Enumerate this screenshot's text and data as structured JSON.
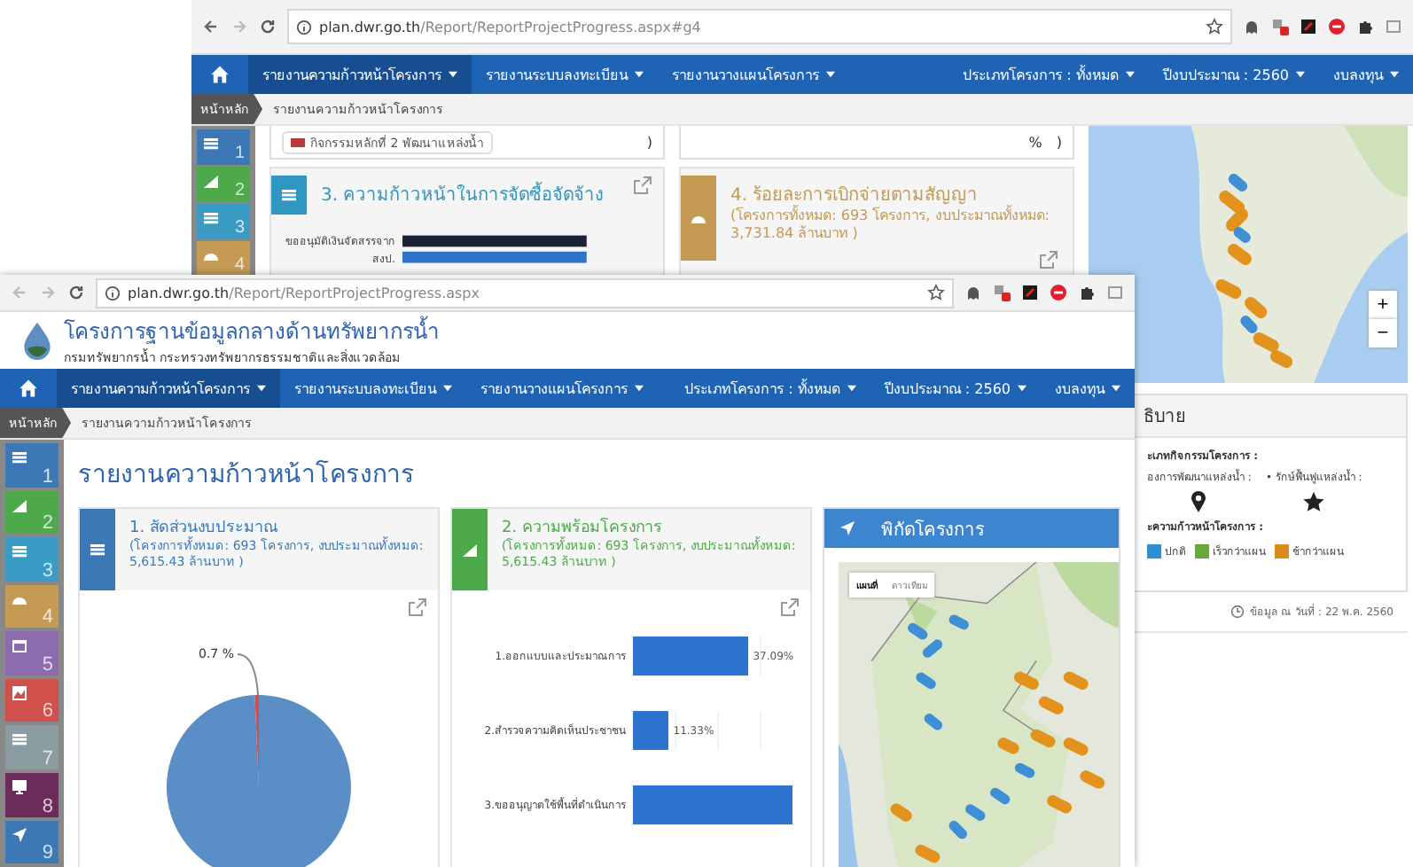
{
  "back_window": {
    "browser": {
      "url_host": "plan.dwr.go.th",
      "url_path": "/Report/ReportProjectProgress.aspx#g4"
    },
    "navbar": {
      "menus": [
        {
          "label": "รายงานความก้าวหน้าโครงการ",
          "selected": true
        },
        {
          "label": "รายงานระบบลงทะเบียน",
          "selected": false
        },
        {
          "label": "รายงานวางแผนโครงการ",
          "selected": false
        }
      ],
      "filters": [
        "ประเภทโครงการ : ทั้งหมด",
        "ปีงบประมาณ : 2560",
        "งบลงทุน"
      ]
    },
    "breadcrumb": {
      "home": "หน้าหลัก",
      "current": "รายงานความก้าวหน้าโครงการ"
    },
    "rail": [
      {
        "number": "1",
        "color": "#3b78b5"
      },
      {
        "number": "2",
        "color": "#4da94a"
      },
      {
        "number": "3",
        "color": "#3a9cc4"
      },
      {
        "number": "4",
        "color": "#c49a55"
      }
    ],
    "upper_cards": {
      "chip_label": "กิจกรรมหลักที่ 2 พัฒนาแหล่งน้ำ",
      "percent_mark": "%",
      "closing_marks": [
        ")",
        ")"
      ]
    },
    "cards": [
      {
        "title": "3. ความก้าวหน้าในการจัดซื้อจัดจ้าง",
        "color": "#2f97c1"
      },
      {
        "title": "4. ร้อยละการเบิกจ่ายตามสัญญา",
        "subtitle": "(โครงการทั้งหมด: 693 โครงการ, งบประมาณทั้งหมด: 3,731.84 ล้านบาท )",
        "color": "#c49a55"
      }
    ],
    "bar_label": "ขออนุมัติเงินจัดสรรจาก สงป.",
    "map": {
      "zoom_in": "+",
      "zoom_out": "−"
    },
    "legend": {
      "title": "ธิบาย",
      "type_heading": "ะเภทกิจกรรมโครงการ :",
      "types": [
        {
          "label": "องการพัฒนาแหล่งน้ำ :",
          "kind": "pin"
        },
        {
          "label": "• รักษ์ฟื้นฟูแหล่งน้ำ :",
          "kind": "star"
        }
      ],
      "progress_heading": "ะความก้าวหน้าโครงการ :",
      "statuses": [
        {
          "label": "ปกติ",
          "color": "#2f8fd6"
        },
        {
          "label": "เร็วกว่าแผน",
          "color": "#6aa83a"
        },
        {
          "label": "ช้ากว่าแผน",
          "color": "#d98b1c"
        }
      ]
    },
    "updated": "ข้อมูล ณ วันที่ : 22 พ.ค. 2560"
  },
  "front_window": {
    "browser": {
      "url_host": "plan.dwr.go.th",
      "url_path": "/Report/ReportProjectProgress.aspx"
    },
    "header": {
      "title": "โครงการฐานข้อมูลกลางด้านทรัพยากรน้ำ",
      "subtitle": "กรมทรัพยากรน้ำ กระทรวงทรัพยากรธรรมชาติและสิ่งแวดล้อม"
    },
    "navbar": {
      "menus": [
        {
          "label": "รายงานความก้าวหน้าโครงการ",
          "selected": true
        },
        {
          "label": "รายงานระบบลงทะเบียน",
          "selected": false
        },
        {
          "label": "รายงานวางแผนโครงการ",
          "selected": false
        }
      ],
      "filters": [
        "ประเภทโครงการ : ทั้งหมด",
        "ปีงบประมาณ : 2560",
        "งบลงทุน"
      ]
    },
    "breadcrumb": {
      "home": "หน้าหลัก",
      "current": "รายงานความก้าวหน้าโครงการ"
    },
    "rail": [
      {
        "number": "1",
        "color": "#3b78b5"
      },
      {
        "number": "2",
        "color": "#4da94a"
      },
      {
        "number": "3",
        "color": "#3a9cc4"
      },
      {
        "number": "4",
        "color": "#c49a55"
      },
      {
        "number": "5",
        "color": "#8c6cae"
      },
      {
        "number": "6",
        "color": "#d0504c"
      },
      {
        "number": "7",
        "color": "#8b9ca3"
      },
      {
        "number": "8",
        "color": "#6b2c5c"
      },
      {
        "number": "9",
        "color": "#3b78b5"
      }
    ],
    "page_title": "รายงานความก้าวหน้าโครงการ",
    "cards": [
      {
        "title": "1. สัดส่วนงบประมาณ",
        "subtitle": "(โครงการทั้งหมด: 693 โครงการ, งบประมาณทั้งหมด: 5,615.43 ล้านบาท )",
        "color": "#3b78b5",
        "chart_data": {
          "type": "pie",
          "values": [
            99.3,
            0.7
          ],
          "value_labels": [
            null,
            "0.7 %"
          ]
        }
      },
      {
        "title": "2. ความพร้อมโครงการ",
        "subtitle": "(โครงการทั้งหมด: 693 โครงการ, งบประมาณทั้งหมด: 5,615.43 ล้านบาท )",
        "color": "#4da94a",
        "chart_data": {
          "type": "bar",
          "orientation": "horizontal",
          "categories": [
            "1.ออกแบบและประมาณการ",
            "2.สำรวจความคิดเห็นประชาชน",
            "3.ขออนุญาตใช้พื้นที่ดำเนินการ"
          ],
          "values": [
            37.09,
            11.33,
            51.58
          ],
          "xlim": [
            0,
            55
          ],
          "value_labels": [
            "37.09%",
            "11.33%",
            null
          ]
        }
      }
    ],
    "map_card": {
      "title": "พิกัดโครงการ",
      "map_types": [
        {
          "label": "แผนที่",
          "selected": true
        },
        {
          "label": "ดาวเทียม",
          "selected": false
        }
      ]
    }
  }
}
